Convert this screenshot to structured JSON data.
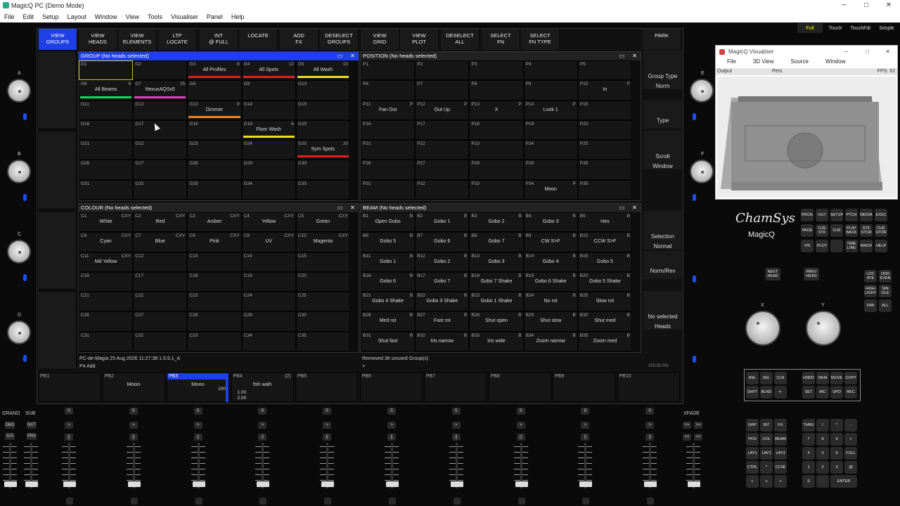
{
  "title": "MagicQ PC (Demo Mode)",
  "window_controls": [
    "─",
    "□",
    "✕"
  ],
  "menu": [
    "File",
    "Edit",
    "Setup",
    "Layout",
    "Window",
    "View",
    "Tools",
    "Visualiser",
    "Panel",
    "Help"
  ],
  "modes": [
    {
      "label": "Full",
      "active": true
    },
    {
      "label": "Touch",
      "active": false
    },
    {
      "label": "TouchFdr",
      "active": false
    },
    {
      "label": "Simple",
      "active": false
    }
  ],
  "top_buttons": [
    {
      "l1": "VIEW",
      "l2": "GROUPS",
      "active": true
    },
    {
      "l1": "VIEW",
      "l2": "HEADS"
    },
    {
      "l1": "VIEW",
      "l2": "ELEMENTS"
    },
    {
      "l1": "LTP",
      "l2": "LOCATE"
    },
    {
      "l1": "INT",
      "l2": "@ FULL"
    },
    {
      "l1": "LOCATE",
      "l2": ""
    },
    {
      "l1": "ADD",
      "l2": "FX"
    },
    {
      "l1": "DESELECT",
      "l2": "GROUPS"
    },
    {
      "l1": "VIEW",
      "l2": "GRID"
    },
    {
      "l1": "VIEW",
      "l2": "PLOT"
    },
    {
      "l1": "DESELECT",
      "l2": "ALL"
    },
    {
      "l1": "SELECT",
      "l2": "FN"
    },
    {
      "l1": "SELECT",
      "l2": "FN TYPE"
    },
    {
      "l1": "PARK",
      "l2": ""
    }
  ],
  "right_column": [
    {
      "l1": "Group Type",
      "l2": "Norm"
    },
    {
      "l1": "",
      "l2": "Type"
    },
    {
      "l1": "Scroll",
      "l2": "Window"
    },
    {
      "l1": "Selection",
      "l2": "Normal"
    },
    {
      "l1": "",
      "l2": "Norm/Rev"
    },
    {
      "l1": "No selected",
      "l2": "Heads"
    }
  ],
  "right_column_footer": "100.50.0%",
  "group_window": {
    "title": "GROUP (No heads selected)",
    "cells": [
      {
        "id": "G1",
        "sel": true
      },
      {
        "id": "G2"
      },
      {
        "id": "G3",
        "cnt": "8",
        "lbl": "All Profiles",
        "bar": "#e02020"
      },
      {
        "id": "G4",
        "cnt": "12",
        "lbl": "All Spots",
        "bar": "#e02020"
      },
      {
        "id": "G5",
        "cnt": "10",
        "lbl": "All Wash",
        "bar": "#e8e020"
      },
      {
        "id": "G6",
        "cnt": "8",
        "lbl": "All Beams",
        "bar": "#20d060"
      },
      {
        "id": "G7",
        "cnt": "25",
        "lbl": "NexusAQSx5",
        "bar": "#e040c0"
      },
      {
        "id": "G8"
      },
      {
        "id": "G9"
      },
      {
        "id": "G10"
      },
      {
        "id": "G11"
      },
      {
        "id": "G12"
      },
      {
        "id": "G13",
        "cnt": "8",
        "lbl": "Dimmer",
        "bar": "#f08020"
      },
      {
        "id": "G14"
      },
      {
        "id": "G15"
      },
      {
        "id": "G16"
      },
      {
        "id": "G17"
      },
      {
        "id": "G18"
      },
      {
        "id": "G19",
        "cnt": "6",
        "lbl": "Floor Wash",
        "bar": "#e8e020"
      },
      {
        "id": "G20"
      },
      {
        "id": "G21"
      },
      {
        "id": "G22"
      },
      {
        "id": "G23"
      },
      {
        "id": "G24"
      },
      {
        "id": "G25",
        "cnt": "20",
        "lbl": "Sym Spots",
        "bar": "#e02020"
      },
      {
        "id": "G26"
      },
      {
        "id": "G27"
      },
      {
        "id": "G28"
      },
      {
        "id": "G29"
      },
      {
        "id": "G30"
      },
      {
        "id": "G31"
      },
      {
        "id": "G32"
      },
      {
        "id": "G33"
      },
      {
        "id": "G34"
      },
      {
        "id": "G35"
      }
    ]
  },
  "position_window": {
    "title": "POSITION (No heads selected)",
    "cells": [
      {
        "id": "P1"
      },
      {
        "id": "P2"
      },
      {
        "id": "P3"
      },
      {
        "id": "P4"
      },
      {
        "id": "P5"
      },
      {
        "id": "P6"
      },
      {
        "id": "P7"
      },
      {
        "id": "P8"
      },
      {
        "id": "P9"
      },
      {
        "id": "P10",
        "cnt": "P",
        "lbl": "In"
      },
      {
        "id": "P11",
        "cnt": "P",
        "lbl": "Fan Out"
      },
      {
        "id": "P12",
        "cnt": "P",
        "lbl": "Out Up"
      },
      {
        "id": "P13",
        "cnt": "P",
        "lbl": "X"
      },
      {
        "id": "P14",
        "cnt": "P",
        "lbl": "Look 1"
      },
      {
        "id": "P15"
      },
      {
        "id": "P16"
      },
      {
        "id": "P17"
      },
      {
        "id": "P18"
      },
      {
        "id": "P19"
      },
      {
        "id": "P20"
      },
      {
        "id": "P21"
      },
      {
        "id": "P22"
      },
      {
        "id": "P23"
      },
      {
        "id": "P24"
      },
      {
        "id": "P25"
      },
      {
        "id": "P26"
      },
      {
        "id": "P27"
      },
      {
        "id": "P28"
      },
      {
        "id": "P29"
      },
      {
        "id": "P30"
      },
      {
        "id": "P31"
      },
      {
        "id": "P32"
      },
      {
        "id": "P33"
      },
      {
        "id": "P34",
        "cnt": "P",
        "lbl": "Moon"
      },
      {
        "id": "P35"
      }
    ]
  },
  "colour_window": {
    "title": "COLOUR (No heads selected)",
    "cells": [
      {
        "id": "C1",
        "cnt": "CXY",
        "lbl": "White"
      },
      {
        "id": "C2",
        "cnt": "CXY",
        "lbl": "Red"
      },
      {
        "id": "C3",
        "cnt": "CXY",
        "lbl": "Amber"
      },
      {
        "id": "C4",
        "cnt": "CXY",
        "lbl": "Yellow"
      },
      {
        "id": "C5",
        "cnt": "CXY",
        "lbl": "Green"
      },
      {
        "id": "C6",
        "cnt": "CXY",
        "lbl": "Cyan"
      },
      {
        "id": "C7",
        "cnt": "CXY",
        "lbl": "Blue"
      },
      {
        "id": "C8",
        "cnt": "CXY",
        "lbl": "Pink"
      },
      {
        "id": "C9",
        "cnt": "CXY",
        "lbl": "UV"
      },
      {
        "id": "C10",
        "cnt": "CXY",
        "lbl": "Magenta"
      },
      {
        "id": "C11",
        "cnt": "CXY",
        "lbl": "Md Yellow"
      },
      {
        "id": "C12"
      },
      {
        "id": "C13"
      },
      {
        "id": "C14"
      },
      {
        "id": "C15"
      },
      {
        "id": "C16"
      },
      {
        "id": "C17"
      },
      {
        "id": "C18"
      },
      {
        "id": "C19"
      },
      {
        "id": "C20"
      },
      {
        "id": "C21"
      },
      {
        "id": "C22"
      },
      {
        "id": "C23"
      },
      {
        "id": "C24"
      },
      {
        "id": "C25"
      },
      {
        "id": "C26"
      },
      {
        "id": "C27"
      },
      {
        "id": "C28"
      },
      {
        "id": "C29"
      },
      {
        "id": "C30"
      },
      {
        "id": "C31"
      },
      {
        "id": "C32"
      },
      {
        "id": "C33"
      },
      {
        "id": "C34"
      },
      {
        "id": "C35"
      }
    ]
  },
  "beam_window": {
    "title": "BEAM (No heads selected)",
    "cells": [
      {
        "id": "B1",
        "cnt": "B",
        "lbl": "Open Gobo"
      },
      {
        "id": "B2",
        "cnt": "B",
        "lbl": "Gobo 1"
      },
      {
        "id": "B3",
        "cnt": "B",
        "lbl": "Gobo 2"
      },
      {
        "id": "B4",
        "cnt": "B",
        "lbl": "Gobo 3"
      },
      {
        "id": "B5",
        "cnt": "B",
        "lbl": "Hex"
      },
      {
        "id": "B6",
        "cnt": "B",
        "lbl": "Gobo 5"
      },
      {
        "id": "B7",
        "cnt": "B",
        "lbl": "Gobo 6"
      },
      {
        "id": "B8",
        "cnt": "B",
        "lbl": "Gobo 7"
      },
      {
        "id": "B9",
        "cnt": "B",
        "lbl": "CW S>F"
      },
      {
        "id": "B10",
        "cnt": "B",
        "lbl": "CCW S>F"
      },
      {
        "id": "B11",
        "cnt": "B",
        "lbl": "Gobo 1"
      },
      {
        "id": "B12",
        "cnt": "B",
        "lbl": "Gobo 2"
      },
      {
        "id": "B13",
        "cnt": "B",
        "lbl": "Gobo 3"
      },
      {
        "id": "B14",
        "cnt": "B",
        "lbl": "Gobo 4"
      },
      {
        "id": "B15",
        "cnt": "B",
        "lbl": "Gobo 5"
      },
      {
        "id": "B16",
        "cnt": "B",
        "lbl": "Gobo 6"
      },
      {
        "id": "B17",
        "cnt": "B",
        "lbl": "Gobo 7"
      },
      {
        "id": "B18",
        "cnt": "B",
        "lbl": "Gobo 7 Shake"
      },
      {
        "id": "B19",
        "cnt": "B",
        "lbl": "Gobo 6 Shake"
      },
      {
        "id": "B20",
        "cnt": "B",
        "lbl": "Gobo 5 Shake"
      },
      {
        "id": "B21",
        "cnt": "B",
        "lbl": "Gobo 4 Shake"
      },
      {
        "id": "B22",
        "cnt": "B",
        "lbl": "Gobo 3 Shake"
      },
      {
        "id": "B23",
        "cnt": "B",
        "lbl": "Gobo 1 Shake"
      },
      {
        "id": "B24",
        "cnt": "B",
        "lbl": "No rot"
      },
      {
        "id": "B25",
        "cnt": "B",
        "lbl": "Slow rot"
      },
      {
        "id": "B26",
        "cnt": "B",
        "lbl": "Med rot"
      },
      {
        "id": "B27",
        "cnt": "B",
        "lbl": "Fast rot"
      },
      {
        "id": "B28",
        "cnt": "B",
        "lbl": "Shut open"
      },
      {
        "id": "B29",
        "cnt": "B",
        "lbl": "Shut slow"
      },
      {
        "id": "B30",
        "cnt": "B",
        "lbl": "Shut med"
      },
      {
        "id": "B31",
        "cnt": "B",
        "lbl": "Shut fast"
      },
      {
        "id": "B32",
        "cnt": "B",
        "lbl": "Iris narrow"
      },
      {
        "id": "B33",
        "cnt": "B",
        "lbl": "Iris wide"
      },
      {
        "id": "B34",
        "cnt": "B",
        "lbl": "Zoom narrow"
      },
      {
        "id": "B35",
        "cnt": "B",
        "lbl": "Zoom med"
      }
    ]
  },
  "status": {
    "left_line1": "PC-de-Magia 25 Aug 2026 11:27:38 1.9.9.1_A",
    "left_line2": "P4  Add",
    "right_line1": "Removed 36 unused Group(s)",
    "right_line2": ">"
  },
  "playbacks": [
    {
      "id": "PB1"
    },
    {
      "id": "PB2",
      "name": "Moon"
    },
    {
      "id": "PB3",
      "name": "Moon",
      "level": "100",
      "active": true
    },
    {
      "id": "PB4",
      "name": "foh wah",
      "extra": "(2)",
      "v1": "1.00",
      "v2": "2.00"
    },
    {
      "id": "PB5"
    },
    {
      "id": "PB6"
    },
    {
      "id": "PB7"
    },
    {
      "id": "PB8"
    },
    {
      "id": "PB9"
    },
    {
      "id": "PB10"
    }
  ],
  "encoders_left": [
    "A",
    "B",
    "C",
    "D"
  ],
  "encoders_right": [
    "E",
    "F"
  ],
  "xy_labels": [
    "X",
    "Y"
  ],
  "fader_labels": {
    "grand": "GRAND",
    "sub": "SUB",
    "xfade": "XFADE"
  },
  "grand_buttons": [
    "DBO",
    "NXT",
    "A/S",
    "PRV"
  ],
  "fader_button_glyphs": {
    "s": "S",
    "go": ">",
    "pause": "||"
  },
  "xfade_buttons": [
    ">>",
    "<<"
  ],
  "visualiser": {
    "title": "MagicQ Visualiser",
    "menu": [
      "File",
      "3D View",
      "Source",
      "Window"
    ],
    "bar_left": "Output",
    "bar_mid": "Pers",
    "bar_right": "FPS: 62"
  },
  "brand": {
    "name": "ChamSys",
    "product": "MagicQ"
  },
  "prog_buttons": [
    "PROG",
    "OUT",
    "SETUP",
    "PTCH",
    "MEDIA",
    "EXEC",
    "PAGE",
    "CUE STK",
    "CUE",
    "PLAY BACK",
    "STK STOR",
    "CUE STOR",
    "VIS",
    "PLOT",
    "",
    "TIME LINE",
    "MACR",
    "HELP"
  ],
  "head_buttons": [
    "NEXT HEAD",
    "PREV HEAD"
  ],
  "side_buttons": [
    "LOC ATE",
    "ODD EVEN",
    "HIGH LIGHT",
    "SIN GLE",
    "FAN",
    "ALL"
  ],
  "edit_buttons": [
    "REL",
    "SEL",
    "CLR",
    "UNDO",
    "REM",
    "MOVE",
    "COPY",
    "SHFT",
    "BLND",
    "<-",
    "SET",
    "INC",
    "UPD",
    "REC"
  ],
  "numpad": [
    "GRP",
    "INT",
    "FX",
    "THRU",
    "/",
    "*",
    "-",
    "POS",
    "COL",
    "BEAM",
    "7",
    "8",
    "9",
    "+",
    "LAY1",
    "LAY2",
    "LAY3",
    "4",
    "5",
    "6",
    "FULL",
    "CTRL",
    "^",
    "CLSE",
    "1",
    "2",
    "3",
    "@",
    "<",
    "v",
    ">",
    "0",
    ".",
    "ENTER"
  ]
}
